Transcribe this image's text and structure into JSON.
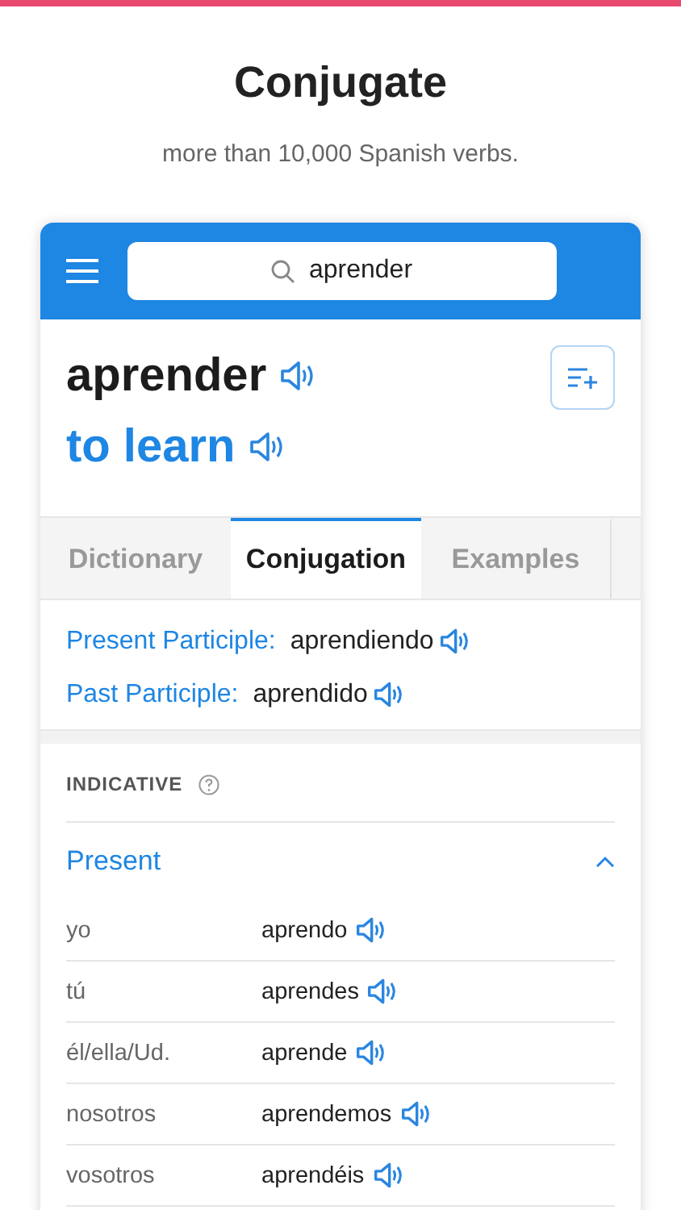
{
  "header": {
    "title": "Conjugate",
    "subtitle": "more than 10,000 Spanish verbs."
  },
  "search": {
    "value": "aprender"
  },
  "entry": {
    "word": "aprender",
    "translation": "to learn"
  },
  "tabs": [
    {
      "label": "Dictionary",
      "selected": false
    },
    {
      "label": "Conjugation",
      "selected": true
    },
    {
      "label": "Examples",
      "selected": false
    }
  ],
  "participles": [
    {
      "label": "Present Participle:",
      "value": "aprendiendo"
    },
    {
      "label": "Past Participle:",
      "value": "aprendido"
    }
  ],
  "mood": {
    "label": "INDICATIVE"
  },
  "tense": {
    "label": "Present",
    "expanded": true
  },
  "rows": [
    {
      "pronoun": "yo",
      "form": "aprendo"
    },
    {
      "pronoun": "tú",
      "form": "aprendes"
    },
    {
      "pronoun": "él/ella/Ud.",
      "form": "aprende"
    },
    {
      "pronoun": "nosotros",
      "form": "aprendemos"
    },
    {
      "pronoun": "vosotros",
      "form": "aprendéis"
    }
  ]
}
